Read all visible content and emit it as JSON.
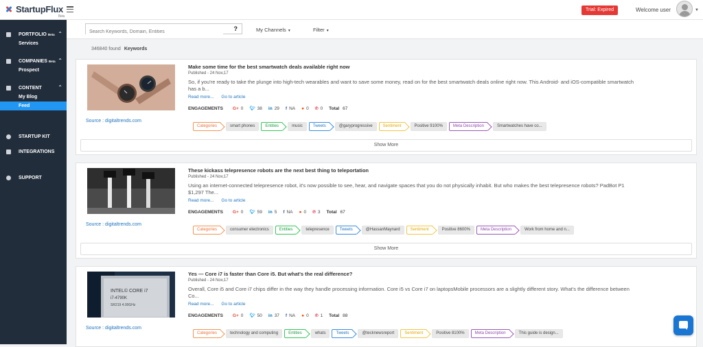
{
  "app": {
    "logo_text": "StartupFlux",
    "logo_badge": "Beta"
  },
  "topbar": {
    "trial": "Trial: Expired",
    "welcome": "Welcome user"
  },
  "sidebar": {
    "portfolio": {
      "label": "PORTFOLIO",
      "badge": "Beta",
      "sub": [
        "Services"
      ]
    },
    "companies": {
      "label": "COMPANIES",
      "badge": "Beta",
      "sub": [
        "Prospect"
      ]
    },
    "content": {
      "label": "CONTENT",
      "sub": [
        "My Blog",
        "Feed"
      ],
      "active": "Feed"
    },
    "startup_kit": "STARTUP KIT",
    "integrations": "INTEGRATIONS",
    "support": "SUPPORT"
  },
  "filters": {
    "search_placeholder": "Search Keywords, Domain, Entities",
    "search_help": "?",
    "channels": "My Channels",
    "filter": "Filter"
  },
  "results": {
    "count": "346840 found",
    "mode": "Keywords"
  },
  "common": {
    "read_more": "Read more...",
    "go_to_article": "Go to article",
    "engagements": "ENGAGEMENTS",
    "total": "Total",
    "show_more": "Show More",
    "categories": "Categories",
    "entities": "Entities",
    "tweets": "Tweets",
    "sentiment": "Sentiment",
    "meta_description": "Meta Description"
  },
  "articles": [
    {
      "title": "Make some time for the best smartwatch deals available right now",
      "published": "Published - 24 Nov,17",
      "description": "So, if you're ready to take the plunge into high-tech wearables and want to save some money, read on for the best smartwatch deals online right now. This Android- and iOS-compatible smartwatch has a b...",
      "source": "Source : digitaltrends.com",
      "engagement": {
        "google": "0",
        "twitter": "38",
        "linkedin": "29",
        "facebook": "NA",
        "reddit": "0",
        "pinterest": "0",
        "total": "67"
      },
      "category": "smart phones",
      "entity": "music",
      "tweet": "@garyprogressive",
      "sentiment": "Positive 9100%",
      "meta": "Smartwatches have co..."
    },
    {
      "title": "These kickass telepresence robots are the next best thing to teleportation",
      "published": "Published - 24 Nov,17",
      "description": "Using an internet-connected telepresence robot, it's now possible to see, hear, and navigate spaces that you do not physically inhabit. But who makes the best telepresence robots? PadBot P1 $1,297 The...",
      "source": "Source : digitaltrends.com",
      "engagement": {
        "google": "0",
        "twitter": "59",
        "linkedin": "5",
        "facebook": "NA",
        "reddit": "0",
        "pinterest": "3",
        "total": "67"
      },
      "category": "consumer electronics",
      "entity": "telepresence",
      "tweet": "@HassanMaynard",
      "sentiment": "Positive 8600%",
      "meta": "Work from home and n..."
    },
    {
      "title": "Yes — Core i7 is faster than Core i5. But what's the real difference?",
      "published": "Published - 24 Nov,17",
      "description": "Overall, Core i5 and Core i7 chips differ in the way they handle processing information. Core i5 vs Core i7 on laptopsMobile processors are a slightly different story. What's the difference between Co...",
      "source": "Source : digitaltrends.com",
      "engagement": {
        "google": "0",
        "twitter": "50",
        "linkedin": "37",
        "facebook": "NA",
        "reddit": "0",
        "pinterest": "1",
        "total": "88"
      },
      "category": "technology and computing",
      "entity": "whats",
      "tweet": "@tecknewsreport",
      "sentiment": "Positive 8100%",
      "meta": "This guide is design..."
    }
  ]
}
